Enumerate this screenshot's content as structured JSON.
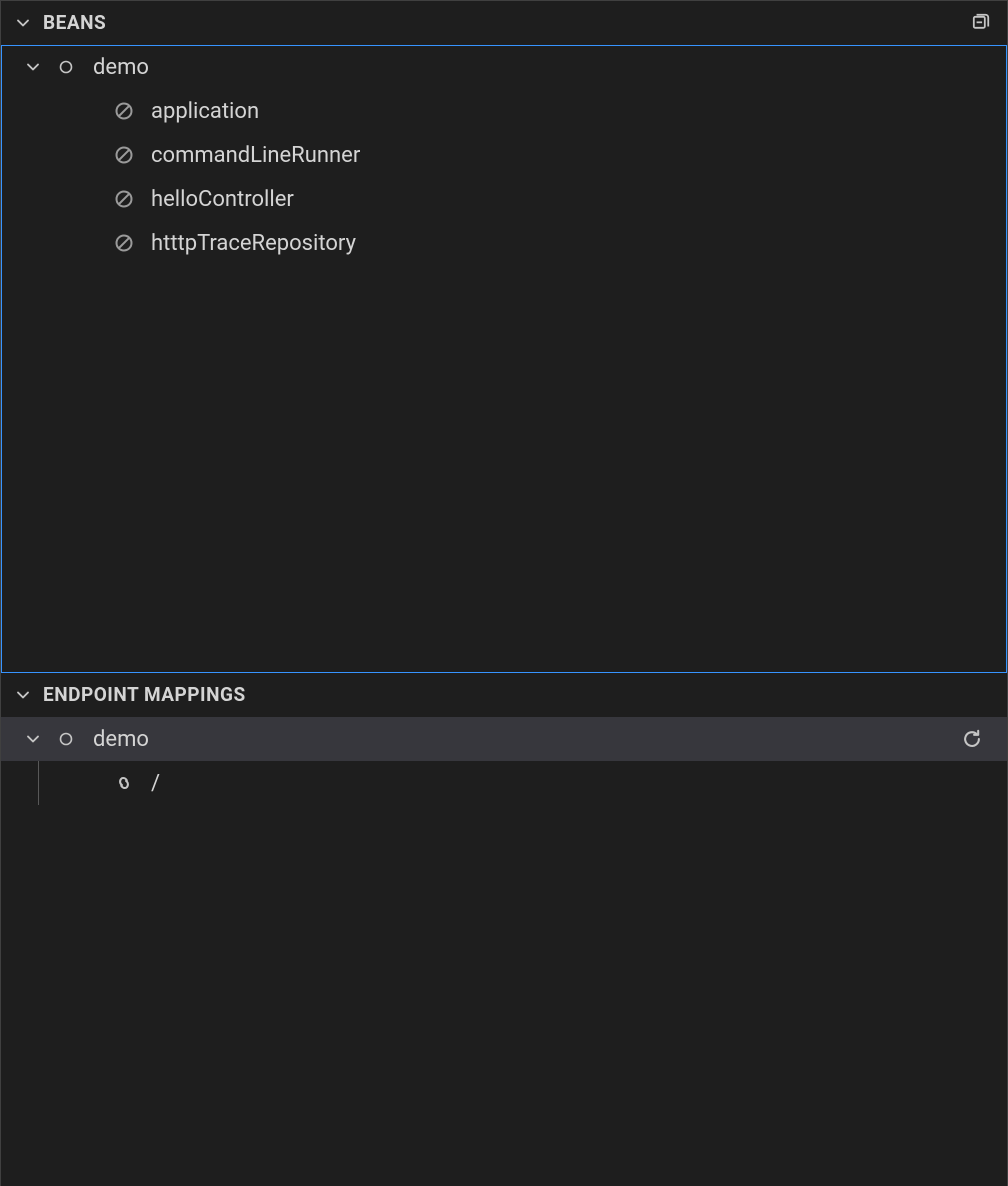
{
  "panels": {
    "beans": {
      "title": "BEANS",
      "project": "demo",
      "items": [
        {
          "label": "application"
        },
        {
          "label": "commandLineRunner"
        },
        {
          "label": "helloController"
        },
        {
          "label": "htttpTraceRepository"
        }
      ]
    },
    "endpoint": {
      "title": "ENDPOINT MAPPINGS",
      "project": "demo",
      "items": [
        {
          "label": "/"
        }
      ]
    }
  }
}
